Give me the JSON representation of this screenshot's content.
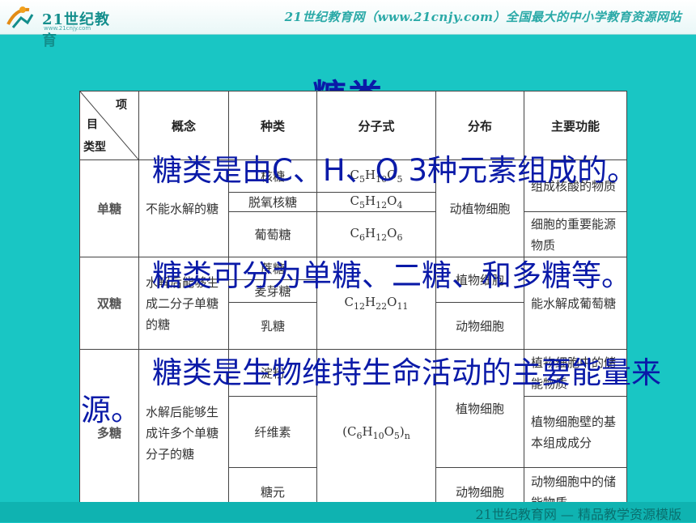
{
  "header": {
    "logo_text": "21世纪教育",
    "logo_sub": "www.21cnjy.com",
    "slogan": "21世纪教育网（www.21cnjy.com）全国最大的中小学教育资源网站"
  },
  "title": "糖类",
  "table": {
    "diag_labels": [
      "项",
      "目",
      "类型"
    ],
    "headers": [
      "概念",
      "种类",
      "分子式",
      "分布",
      "主要功能"
    ],
    "categories": {
      "mono": "单糖",
      "di": "双糖",
      "poly": "多糖"
    },
    "mono": {
      "concept": "不能水解的糖",
      "kinds": [
        "核糖",
        "脱氧核糖",
        "葡萄糖"
      ],
      "formulas": [
        {
          "base": "C",
          "a": "5",
          "h": "10",
          "o": "5"
        },
        {
          "base": "C",
          "a": "5",
          "h": "12",
          "o": "4"
        },
        {
          "base": "C",
          "a": "6",
          "h": "12",
          "o": "6"
        }
      ],
      "dist": "动植物细胞",
      "funcs": [
        "组成核酸的物质",
        "细胞的重要能源物质"
      ]
    },
    "di": {
      "concept": "水解后能够生成二分子单糖的糖",
      "kinds": [
        "蔗糖",
        "麦芽糖",
        "乳糖"
      ],
      "formula": {
        "c": "12",
        "h": "22",
        "o": "11"
      },
      "dist": [
        "植物细胞",
        "动物细胞"
      ],
      "func": "能水解成葡萄糖"
    },
    "poly": {
      "concept": "水解后能够生成许多个单糖分子的糖",
      "kinds": [
        "淀粉",
        "纤维素",
        "糖元"
      ],
      "formula": {
        "c": "6",
        "h": "10",
        "o": "5",
        "n": "n"
      },
      "dist": [
        "植物细胞",
        "动物细胞"
      ],
      "funcs": [
        "植物细胞中的储能物质",
        "植物细胞壁的基本组成成分",
        "动物细胞中的储能物质"
      ]
    }
  },
  "overlay": [
    "糖类是由C、H、O 3种元素组成的。",
    "糖类可分为单糖、二糖、和多糖等。",
    "糖类是生物维持生命活动的主要能量来源。"
  ],
  "footer": "21世纪教育网 — 精品教学资源模版"
}
